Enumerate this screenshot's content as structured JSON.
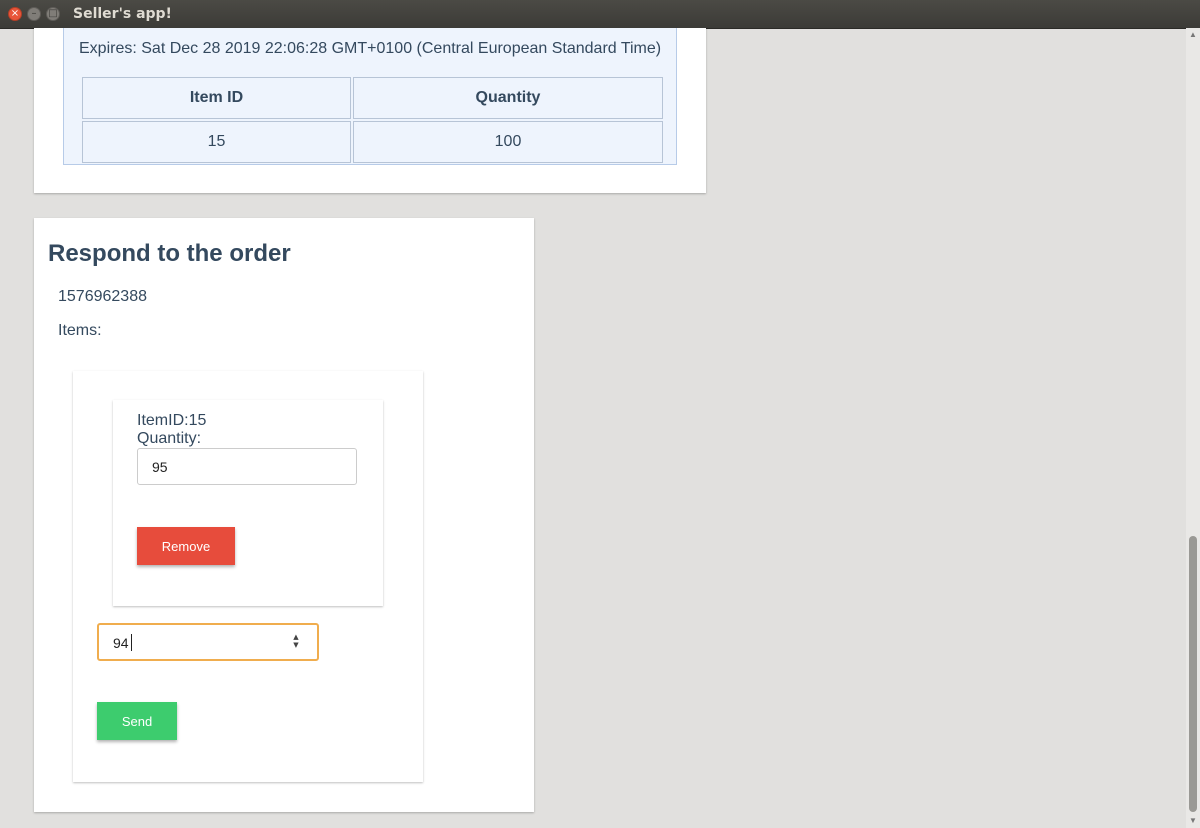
{
  "window": {
    "title": "Seller's app!",
    "close_glyph": "×",
    "min_glyph": "–",
    "max_glyph": "□"
  },
  "order_summary": {
    "expires_text": "Expires: Sat Dec 28 2019 22:06:28 GMT+0100 (Central European Standard Time)",
    "table": {
      "headers": [
        "Item ID",
        "Quantity"
      ],
      "rows": [
        [
          "15",
          "100"
        ]
      ]
    }
  },
  "respond": {
    "heading": "Respond to the order",
    "order_id": "1576962388",
    "items_label": "Items:",
    "item": {
      "item_id_text": "ItemID:15",
      "quantity_label": "Quantity:",
      "quantity_value": "95",
      "remove_label": "Remove"
    },
    "number_input_value": "94",
    "send_label": "Send"
  },
  "scrollbar": {
    "up_glyph": "▲",
    "down_glyph": "▼"
  }
}
